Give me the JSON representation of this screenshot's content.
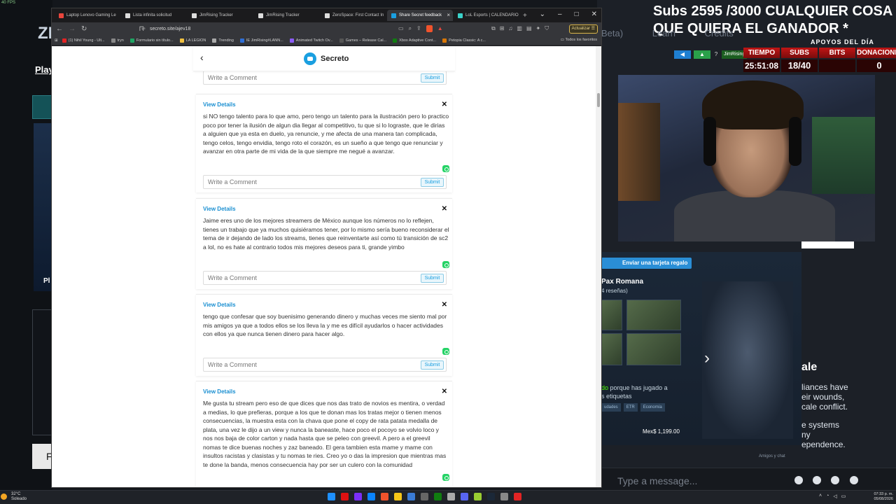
{
  "overlay": {
    "fps": "40 FPS",
    "logo_fragment": "ZI",
    "play_link": "Play",
    "pl_fragment": "Pl",
    "f_fragment": "F",
    "ticker": "Subs 2595 /3000 CUALQUIER COSA QUE QUIERA EL GANADOR *",
    "ghost_tabs": [
      "Beta)",
      "Learn",
      "Credits"
    ],
    "apoyos": "APOYOS DEL DÍA",
    "alert_user": "JimRising",
    "stats": [
      {
        "label": "TIEMPO",
        "value": "25:51:08"
      },
      {
        "label": "SUBS",
        "value": "18/40"
      },
      {
        "label": "BITS",
        "value": ""
      },
      {
        "label": "DONACIONES",
        "value": "0"
      }
    ]
  },
  "steam": {
    "gift_button": "Enviar una tarjeta regalo",
    "game_title": "Pax Romana",
    "reviews": "4 reseñas)",
    "reason_highlight": "do",
    "reason_rest": " porque has jugado a",
    "reason_line2": "s etiquetas",
    "tags": [
      "udades",
      "ETR",
      "Economía"
    ],
    "price": "Mex$ 1,199.00",
    "chat_label": "Amigos y chat"
  },
  "side_text": {
    "title": "ale",
    "lines": [
      "liances have",
      "eir wounds,",
      "cale conflict.",
      "",
      "e systems",
      "ny",
      "ependence."
    ]
  },
  "chatbar": {
    "placeholder": "Type a message..."
  },
  "browser": {
    "tabs": [
      {
        "label": "Laptop Lenovo Gaming Le",
        "color": "#e8453c",
        "active": false
      },
      {
        "label": "Lista infinita solicitud",
        "color": "#dddddd",
        "active": false
      },
      {
        "label": "JimRising Tracker",
        "color": "#dddddd",
        "active": false
      },
      {
        "label": "JimRising Tracker",
        "color": "#dddddd",
        "active": false
      },
      {
        "label": "ZeroSpace: First Contact In",
        "color": "#dddddd",
        "active": false
      },
      {
        "label": "Share Secret feedback",
        "color": "#1a9fe0",
        "active": true
      },
      {
        "label": "LoL Esports | CALENDARIO",
        "color": "#3ad1c9",
        "active": false
      }
    ],
    "url": "secreto.site/ajev18",
    "update_button": "Actualizar",
    "bookmarks": [
      {
        "label": "(1) Nihil Young - Ult...",
        "color": "#e32424"
      },
      {
        "label": "tryn",
        "color": "#888888"
      },
      {
        "label": "Formulario sin título...",
        "color": "#1fa463"
      },
      {
        "label": "LA LEGION",
        "color": "#f0c040"
      },
      {
        "label": "Trending",
        "color": "#aaaaaa"
      },
      {
        "label": "IE JimRising#LANN...",
        "color": "#2f6fd6"
      },
      {
        "label": "Animated Twitch Ov...",
        "color": "#8b5cf6"
      },
      {
        "label": "Games – Release Cal...",
        "color": "#555555"
      },
      {
        "label": "Xbox Adaptive Cont...",
        "color": "#107c10"
      },
      {
        "label": "Petopia Classic: A c...",
        "color": "#d97706"
      }
    ],
    "all_bookmarks": "Todos los favoritos"
  },
  "app": {
    "title": "Secreto",
    "view_details": "View Details",
    "comment_placeholder": "Write a Comment",
    "submit_label": "Submit",
    "secrets": [
      {
        "text": "si NO tengo talento para lo que amo, pero tengo un talento para la ilustración pero lo practico poco por tener la ilusión de algun dia llegar al competitivo, tu que si lo lograste, que le dirias a alguien que ya esta en duelo, ya renuncie, y me afecta de una manera tan complicada, tengo celos, tengo envidia, tengo roto el corazón, es un sueño a que tengo que renunciar y avanzar en otra parte de mi vida de la que siempre me negué a avanzar."
      },
      {
        "text": "Jaime eres uno de los mejores streamers de México aunque los números no lo reflejen, tienes un trabajo que ya muchos quisiéramos tener, por lo mismo sería bueno reconsiderar el tema de ir dejando de lado los streams, tienes que reinventarte así como tú transición de sc2 a lol, no es hate al contrario todos mis mejores deseos para ti, grande yimbo"
      },
      {
        "text": "tengo que confesar que soy buenisimo generando dinero y muchas veces me siento mal por mis amigos ya que a todos ellos se los lleva la y me es difícil ayudarlos o hacer actividades con ellos ya que nunca tienen dinero para hacer algo."
      },
      {
        "text": "Me gusta tu stream pero eso de que dices que nos das trato de novios es mentira, o verdad a medias, lo que prefieras, porque a los que te donan mas los tratas mejor o tienen menos consecuencias, la muestra esta con la chava que pone el copy de rata patata medalla de plata, una vez le dijo a un view y nunca la baneaste, hace poco el pocoyo se volvio loco y nos nos baja de color carton y nada hasta que se peleo con greevil. A pero a el greevil nomas te dice buenas noches y zaz baneado. El gera tambien esta mame y mame con insultos racistas y clasistas y tu nomas te ries. Creo yo o das la impresion que mientras mas te done la banda, menos consecuencia hay por ser un culero con la comunidad"
      }
    ]
  },
  "taskbar": {
    "temperature": "32°C",
    "condition": "Soleado",
    "time": "07:33 p. m.",
    "date": "05/08/2026"
  }
}
